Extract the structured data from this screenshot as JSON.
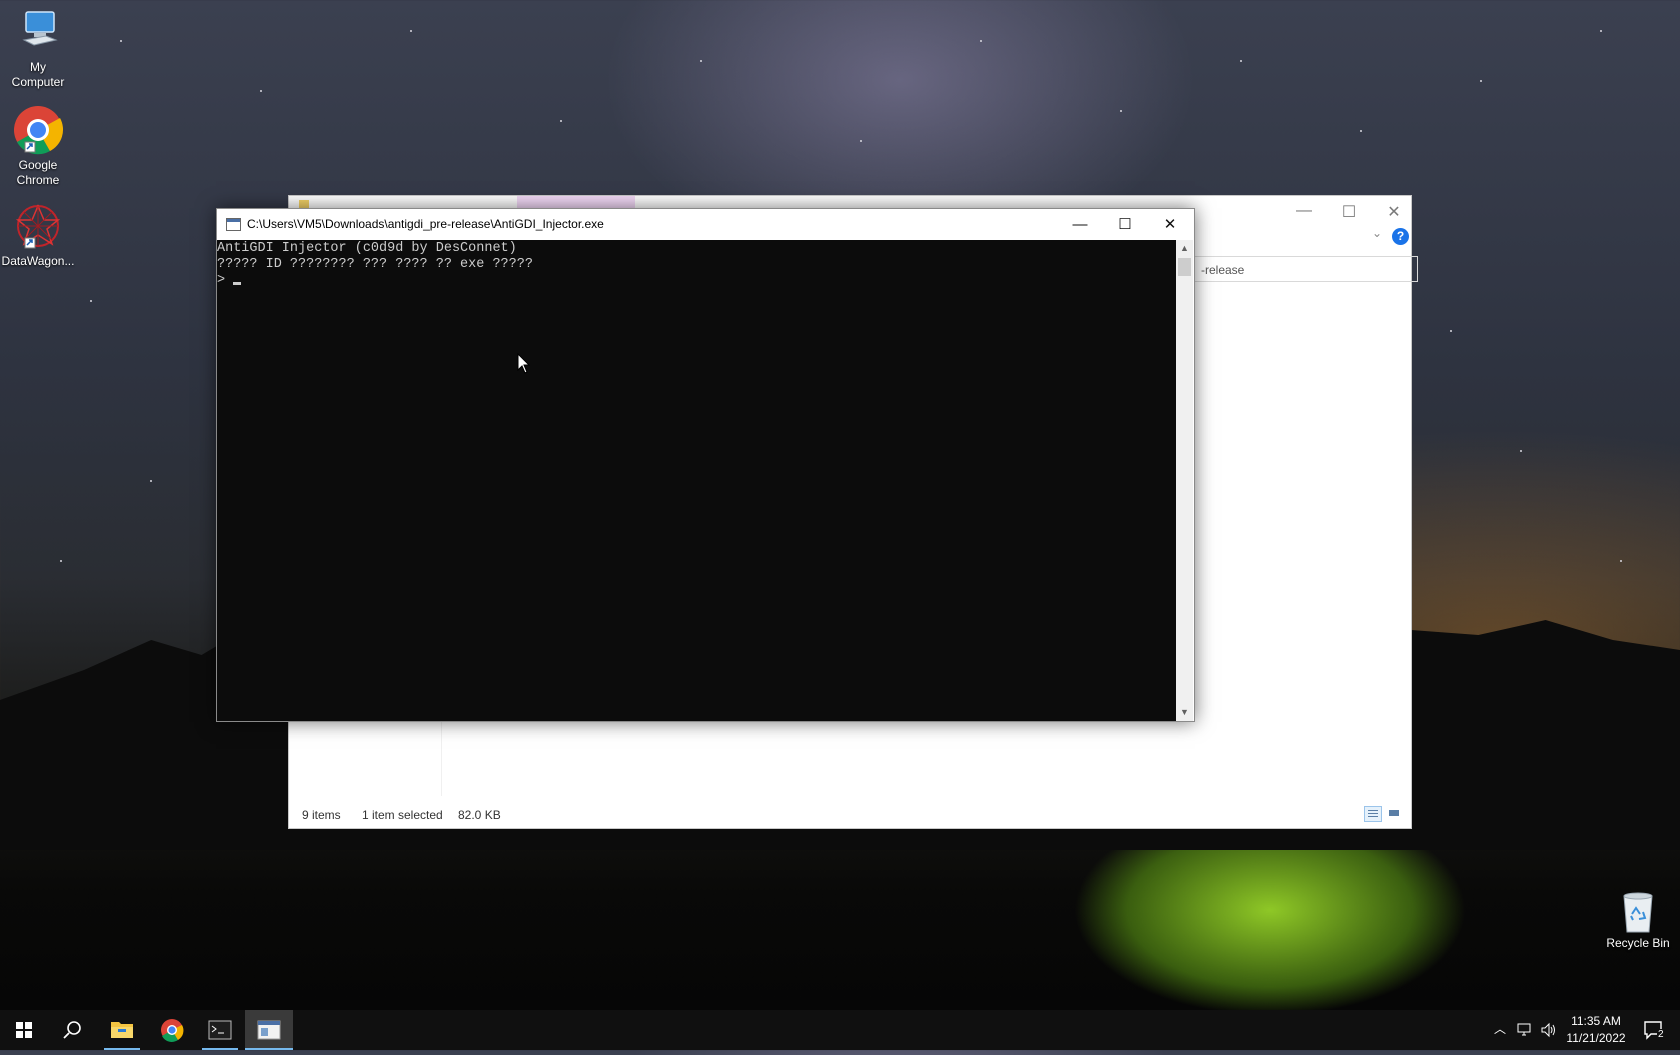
{
  "desktop": {
    "icons": [
      {
        "label_line1": "My",
        "label_line2": "Computer",
        "icon": "computer-icon"
      },
      {
        "label_line1": "Google",
        "label_line2": "Chrome",
        "icon": "chrome-icon"
      },
      {
        "label_line1": "DataWagon...",
        "label_line2": "",
        "icon": "datawagon-icon"
      },
      {
        "label_line1": "Recycle Bin",
        "label_line2": "",
        "icon": "recycle-bin-icon"
      }
    ]
  },
  "explorer": {
    "address_partial": "-release",
    "status": {
      "item_count": "9 items",
      "selection": "1 item selected",
      "size": "82.0 KB"
    },
    "help_glyph": "?"
  },
  "console": {
    "title": "C:\\Users\\VM5\\Downloads\\antigdi_pre-release\\AntiGDI_Injector.exe",
    "lines": [
      "AntiGDI Injector (c0d9d by DesConnet)",
      "????? ID ???????? ??? ???? ?? exe ?????",
      ">"
    ],
    "buttons": {
      "minimize": "—",
      "maximize": "☐",
      "close": "✕"
    }
  },
  "taskbar": {
    "items": [
      "start-button",
      "search-icon",
      "file-explorer-icon",
      "chrome-icon",
      "terminal-icon",
      "antigdi-icon"
    ],
    "clock": {
      "time": "11:35 AM",
      "date": "11/21/2022"
    },
    "notification_count": "2"
  },
  "colors": {
    "console_bg": "#0c0c0c",
    "console_text": "#cccccc",
    "taskbar_bg": "#101010",
    "accent": "#76b9ed"
  }
}
